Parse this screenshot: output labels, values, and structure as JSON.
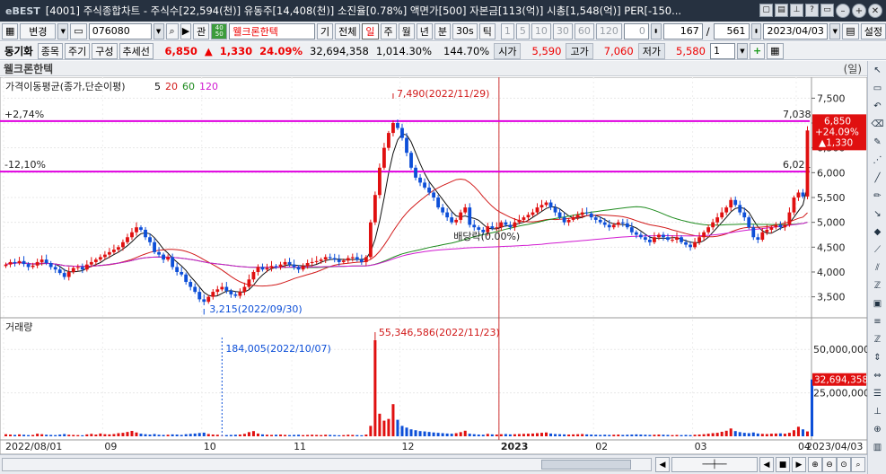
{
  "window": {
    "logo": "eBEST",
    "title": "[4001] 주식종합차트 - 주식수[22,594(천)] 유동주[14,408(천)] 소진율[0.78%] 액면가[500] 자본금[113(억)] 시총[1,548(억)] PER[-150..."
  },
  "toolbar": {
    "mode_label": "변경",
    "code": "076080",
    "nav_arrow": "▶",
    "gwan_label": "관",
    "badge": "40\n50",
    "stock_name": "웰크론한텍",
    "btn_gi": "기",
    "btn_all": "전체",
    "periods": [
      "일",
      "주",
      "월",
      "년",
      "분",
      "30s",
      "틱"
    ],
    "intervals": [
      "1",
      "5",
      "10",
      "30",
      "60",
      "120"
    ],
    "spin_value": "0",
    "count_a": "167",
    "count_sep": "/",
    "count_b": "561",
    "date": "2023/04/03",
    "settings_label": "설정"
  },
  "quote": {
    "sync_label": "동기화",
    "btn_item": "종목",
    "btn_period": "주기",
    "btn_compose": "구성",
    "btn_trend": "추세선",
    "price": "6,850",
    "arrow": "▲",
    "change": "1,330",
    "pct": "24.09%",
    "volume": "32,694,358",
    "turnover": "1,014.30%",
    "ratio": "144.70%",
    "open_label": "시가",
    "open": "5,590",
    "high_label": "고가",
    "high": "7,060",
    "low_label": "저가",
    "low": "5,580",
    "page_num": "1"
  },
  "chart_header": {
    "name": "웰크론한텍",
    "unit": "(일)"
  },
  "chart_data": {
    "type": "candlestick",
    "indicator_label": "가격이동평균(종가,단순이평)",
    "ma_periods": [
      {
        "label": "5",
        "color": "#111111"
      },
      {
        "label": "20",
        "color": "#d11a1a"
      },
      {
        "label": "60",
        "color": "#1c8a1c"
      },
      {
        "label": "120",
        "color": "#d11ad1"
      }
    ],
    "price_axis": [
      "7,500",
      "7,000",
      "6,500",
      "6,000",
      "5,500",
      "5,000",
      "4,500",
      "4,000",
      "3,500"
    ],
    "price_axis_values": [
      7500,
      7000,
      6500,
      6000,
      5500,
      5000,
      4500,
      4000,
      3500
    ],
    "price_range": [
      3150,
      7850
    ],
    "volume_axis": [
      "50,000,000",
      "25,000,000"
    ],
    "volume_axis_values": [
      50000000,
      25000000
    ],
    "volume_range": [
      0,
      62000000
    ],
    "volume_label": "거래량",
    "date_axis": [
      "2022/08/01",
      "09",
      "10",
      "11",
      "12",
      "2023",
      "02",
      "03",
      "04",
      "2023/04/03"
    ],
    "date_axis_sessions": [
      0,
      22,
      44,
      64,
      88,
      110,
      131,
      153,
      176
    ],
    "year_divider_session": 110,
    "resistance_lines": [
      {
        "label": "+2,74%",
        "value": 7038,
        "value_label": "7,038"
      },
      {
        "label": "-12,10%",
        "value": 6021,
        "value_label": "6,021"
      }
    ],
    "high_annotation": {
      "text": "7,490(2022/11/29)",
      "session": 86,
      "value": 7490
    },
    "low_annotation": {
      "text": "3,215(2022/09/30)",
      "session": 44,
      "value": 3215
    },
    "volume_peak": {
      "text": "55,346,586(2022/11/23)",
      "session": 82,
      "value": 55346586
    },
    "volume_low": {
      "text": "184,005(2022/10/07)",
      "session": 48,
      "value": 184005
    },
    "dividend_annotation": {
      "text": "배당락(0.00%)",
      "session": 107
    },
    "current_price": {
      "price": "6,850",
      "pct": "+24.09%",
      "change": "▲1,330"
    },
    "current_volume": "32,694,358",
    "close": [
      4150,
      4200,
      4180,
      4220,
      4160,
      4100,
      4130,
      4200,
      4250,
      4180,
      4100,
      4050,
      3980,
      3900,
      4000,
      4080,
      4100,
      4050,
      4150,
      4200,
      4250,
      4300,
      4350,
      4400,
      4450,
      4500,
      4600,
      4700,
      4800,
      4900,
      4850,
      4700,
      4600,
      4400,
      4350,
      4250,
      4300,
      4100,
      4000,
      3950,
      3800,
      3700,
      3600,
      3450,
      3400,
      3500,
      3600,
      3650,
      3700,
      3620,
      3550,
      3520,
      3600,
      3700,
      3850,
      4000,
      4100,
      4050,
      4080,
      4120,
      4100,
      4150,
      4200,
      4150,
      4100,
      4050,
      4120,
      4180,
      4200,
      4220,
      4250,
      4300,
      4280,
      4250,
      4200,
      4230,
      4280,
      4300,
      4250,
      4200,
      4300,
      5000,
      5550,
      6100,
      6500,
      6800,
      7000,
      6900,
      6700,
      6400,
      6100,
      5900,
      5800,
      5700,
      5600,
      5500,
      5300,
      5200,
      5100,
      5000,
      5050,
      5200,
      5300,
      4950,
      4900,
      4850,
      4800,
      4920,
      4880,
      4900,
      5000,
      4950,
      4900,
      5000,
      5050,
      5100,
      5150,
      5200,
      5300,
      5350,
      5400,
      5300,
      5200,
      5100,
      5000,
      5050,
      5100,
      5150,
      5200,
      5180,
      5100,
      5050,
      5000,
      4950,
      4900,
      4950,
      5000,
      4980,
      4900,
      4800,
      4750,
      4700,
      4650,
      4600,
      4700,
      4750,
      4700,
      4650,
      4650,
      4700,
      4600,
      4550,
      4500,
      4600,
      4700,
      4800,
      4900,
      5000,
      5100,
      5200,
      5300,
      5450,
      5350,
      5200,
      5100,
      4900,
      4700,
      4650,
      4800,
      4850,
      4900,
      4950,
      4900,
      4950,
      5200,
      5500,
      5600,
      5520,
      6850
    ],
    "volume": [
      1.2,
      1.0,
      0.8,
      1.1,
      0.9,
      0.7,
      0.8,
      1.5,
      1.2,
      0.9,
      0.8,
      0.7,
      1.0,
      1.3,
      0.9,
      0.8,
      0.7,
      0.6,
      1.1,
      1.4,
      1.0,
      1.6,
      1.2,
      1.1,
      1.3,
      1.8,
      2.0,
      2.5,
      3.1,
      2.2,
      1.5,
      1.2,
      1.0,
      1.3,
      0.9,
      0.8,
      0.9,
      1.1,
      1.0,
      0.8,
      1.2,
      1.4,
      1.6,
      1.9,
      2.1,
      1.3,
      1.0,
      0.9,
      0.2,
      0.7,
      0.8,
      0.9,
      1.0,
      1.4,
      2.4,
      3.0,
      1.6,
      1.1,
      0.9,
      0.8,
      0.9,
      1.0,
      0.8,
      0.7,
      0.8,
      0.9,
      0.7,
      0.8,
      0.9,
      0.8,
      0.7,
      0.9,
      0.8,
      0.7,
      0.6,
      0.7,
      0.9,
      0.8,
      0.7,
      0.6,
      1.0,
      6.0,
      55.3,
      13.0,
      9.0,
      10.0,
      18.5,
      9.5,
      6.0,
      5.0,
      4.0,
      3.5,
      3.0,
      2.8,
      2.5,
      2.2,
      2.0,
      1.8,
      1.6,
      1.5,
      1.8,
      2.4,
      3.2,
      1.5,
      1.2,
      1.0,
      0.9,
      1.4,
      1.1,
      1.0,
      1.2,
      1.3,
      1.1,
      1.2,
      1.3,
      1.4,
      1.5,
      1.6,
      1.8,
      2.0,
      2.2,
      1.6,
      1.3,
      1.2,
      1.1,
      1.0,
      1.1,
      1.2,
      1.3,
      1.1,
      1.0,
      0.9,
      0.8,
      0.9,
      0.8,
      0.9,
      1.0,
      0.8,
      0.9,
      1.0,
      1.1,
      1.0,
      0.9,
      0.8,
      0.9,
      1.0,
      0.9,
      0.8,
      0.7,
      0.8,
      0.7,
      0.8,
      0.7,
      0.9,
      1.0,
      1.2,
      1.5,
      1.8,
      2.0,
      2.6,
      3.2,
      4.5,
      3.0,
      2.4,
      2.0,
      1.8,
      2.2,
      1.6,
      1.4,
      1.3,
      1.5,
      1.6,
      1.7,
      1.5,
      2.0,
      3.5,
      5.5,
      4.0,
      2.8,
      32.7
    ]
  },
  "colors": {
    "up": "#e01010",
    "down": "#0d4fd8",
    "resistance": "#e000e0",
    "titlebar": "#263140"
  }
}
